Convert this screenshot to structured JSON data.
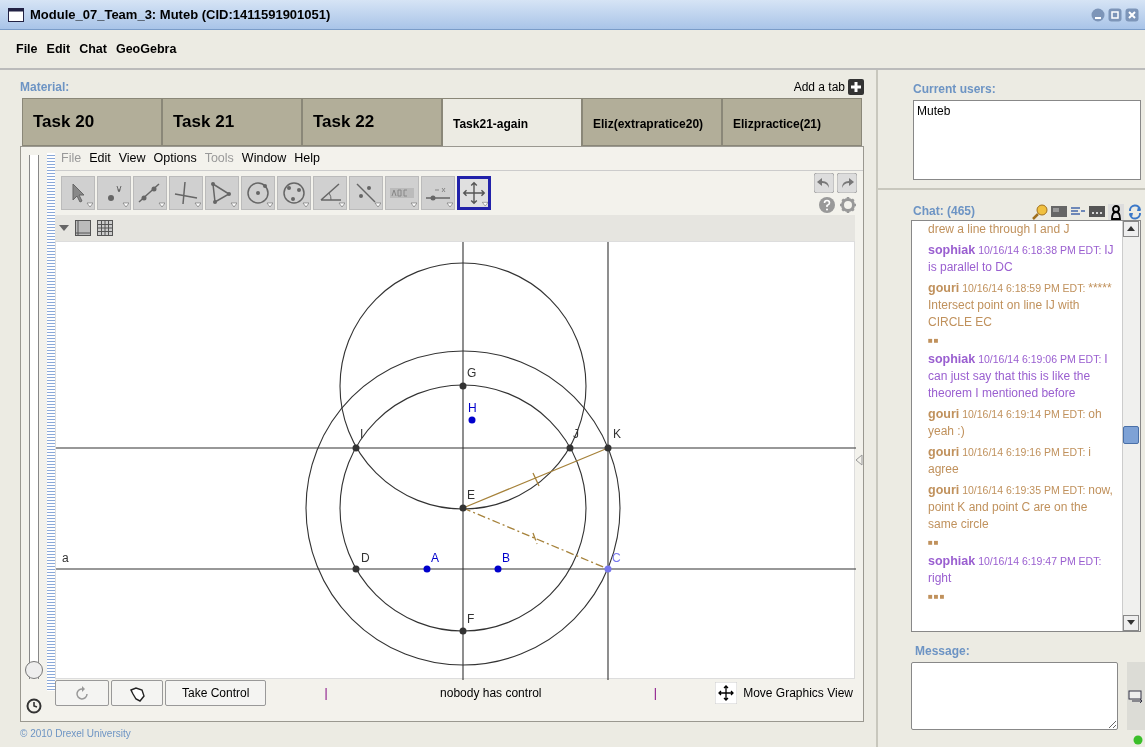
{
  "window": {
    "title": "Module_07_Team_3: Muteb (CID:1411591901051)"
  },
  "menu": [
    "File",
    "Edit",
    "Chat",
    "GeoGebra"
  ],
  "material": {
    "label": "Material:",
    "add_tab": "Add a tab",
    "tabs": [
      {
        "label": "Task 20",
        "selected": false
      },
      {
        "label": "Task 21",
        "selected": false
      },
      {
        "label": "Task 22",
        "selected": false
      },
      {
        "label": "Task21-again",
        "selected": true
      },
      {
        "label": "Eliz(extrapratice20)",
        "selected": false
      },
      {
        "label": "Elizpractice(21)",
        "selected": false
      }
    ]
  },
  "geogebra": {
    "menu": [
      {
        "label": "File",
        "disabled": true
      },
      {
        "label": "Edit",
        "disabled": false
      },
      {
        "label": "View",
        "disabled": false
      },
      {
        "label": "Options",
        "disabled": false
      },
      {
        "label": "Tools",
        "disabled": true
      },
      {
        "label": "Window",
        "disabled": false
      },
      {
        "label": "Help",
        "disabled": false
      }
    ],
    "tools": [
      {
        "kind": "move",
        "selected": false
      },
      {
        "kind": "point",
        "selected": false
      },
      {
        "kind": "line",
        "selected": false
      },
      {
        "kind": "perpendicular",
        "selected": false
      },
      {
        "kind": "polygon",
        "selected": false
      },
      {
        "kind": "circle",
        "selected": false
      },
      {
        "kind": "conic",
        "selected": false
      },
      {
        "kind": "angle",
        "selected": false
      },
      {
        "kind": "reflect",
        "selected": false
      },
      {
        "kind": "text",
        "selected": false
      },
      {
        "kind": "slider",
        "selected": false
      },
      {
        "kind": "pan",
        "selected": true
      }
    ],
    "history_slider": {
      "level": 0
    },
    "line_label": "a",
    "points": [
      {
        "label": "G",
        "color": "#333333"
      },
      {
        "label": "H",
        "color": "#0000cc"
      },
      {
        "label": "I",
        "color": "#333333"
      },
      {
        "label": "J",
        "color": "#333333"
      },
      {
        "label": "K",
        "color": "#333333"
      },
      {
        "label": "E",
        "color": "#333333"
      },
      {
        "label": "D",
        "color": "#333333"
      },
      {
        "label": "A",
        "color": "#0000cc"
      },
      {
        "label": "B",
        "color": "#0000cc"
      },
      {
        "label": "C",
        "color": "#7777ee"
      },
      {
        "label": "F",
        "color": "#333333"
      }
    ],
    "take_control": "Take Control",
    "separator_left": "|",
    "control_status": "nobody has control",
    "separator_right": "|",
    "mode": "Move Graphics View"
  },
  "footer": "© 2010 Drexel University",
  "users": {
    "label": "Current users:",
    "items": [
      "Muteb"
    ]
  },
  "chat": {
    "label": "Chat: (465)",
    "messages": [
      {
        "kind": "continuation",
        "body": "drew a line through I and J",
        "color": "#c0915c"
      },
      {
        "kind": "message",
        "author": "sophiak",
        "time": "10/16/14 6:18:38 PM EDT:",
        "body": "IJ is parallel to DC",
        "color": "#9a5fd0"
      },
      {
        "kind": "message",
        "author": "gouri",
        "time": "10/16/14 6:18:59 PM EDT:",
        "body": "***** Intersect point on line IJ with CIRCLE EC",
        "color": "#c0915c"
      },
      {
        "kind": "marker",
        "body": "■■",
        "color": "#c0915c"
      },
      {
        "kind": "message",
        "author": "sophiak",
        "time": "10/16/14 6:19:06 PM EDT:",
        "body": "I can just say that this is like the theorem I mentioned before",
        "color": "#9a5fd0"
      },
      {
        "kind": "message",
        "author": "gouri",
        "time": "10/16/14 6:19:14 PM EDT:",
        "body": "oh yeah :)",
        "color": "#c0915c"
      },
      {
        "kind": "message",
        "author": "gouri",
        "time": "10/16/14 6:19:16 PM EDT:",
        "body": "i agree",
        "color": "#c0915c"
      },
      {
        "kind": "message",
        "author": "gouri",
        "time": "10/16/14 6:19:35 PM EDT:",
        "body": "now, point K and point C are on the same circle",
        "color": "#c0915c"
      },
      {
        "kind": "marker",
        "body": "■■",
        "color": "#c0915c"
      },
      {
        "kind": "message",
        "author": "sophiak",
        "time": "10/16/14 6:19:47 PM EDT:",
        "body": "right",
        "color": "#9a5fd0"
      },
      {
        "kind": "marker",
        "body": "■■■",
        "color": "#c0915c"
      }
    ]
  },
  "message": {
    "label": "Message:"
  }
}
